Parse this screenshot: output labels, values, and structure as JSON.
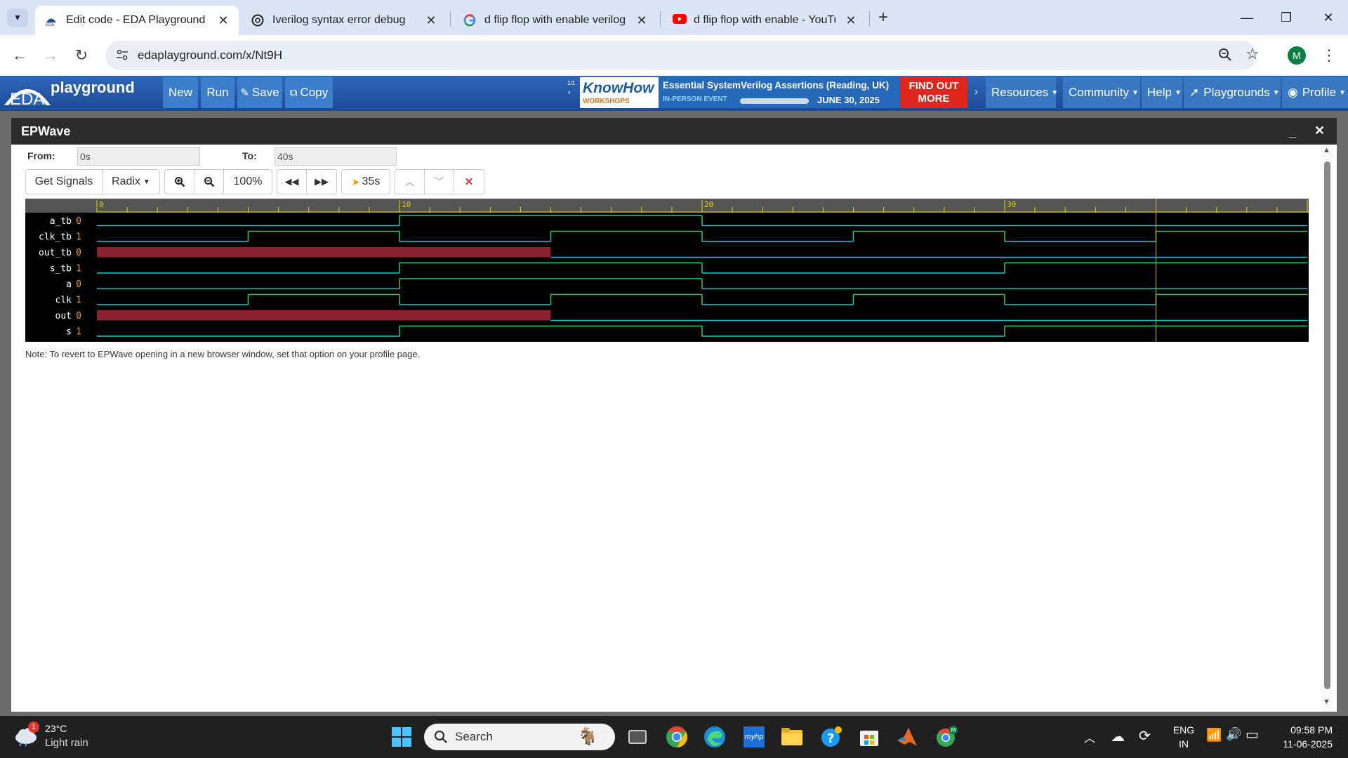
{
  "browser": {
    "tabs": [
      {
        "title": "Edit code - EDA Playground",
        "icon": "eda-icon",
        "active": true
      },
      {
        "title": "Iverilog syntax error debug",
        "icon": "chatgpt-icon",
        "active": false
      },
      {
        "title": "d flip flop with enable verilog co",
        "icon": "google-icon",
        "active": false
      },
      {
        "title": "d flip flop with enable - YouTub",
        "icon": "youtube-icon",
        "active": false
      }
    ],
    "url": "edaplayground.com/x/Nt9H",
    "profile_initial": "M"
  },
  "eda": {
    "logo_text": "EDA",
    "logo_word": "playground",
    "buttons": {
      "new": "New",
      "run": "Run",
      "save": "Save",
      "copy": "Copy"
    },
    "ad": {
      "counter": "1/1",
      "brand": "KnowHow",
      "brand_sub": "WORKSHOPS",
      "title": "Essential SystemVerilog Assertions (Reading, UK)",
      "event_type": "IN-PERSON EVENT",
      "date": "JUNE 30, 2025",
      "cta_line1": "FIND OUT",
      "cta_line2": "MORE"
    },
    "menus": [
      "Resources",
      "Community",
      "Help",
      "Playgrounds",
      "Profile"
    ]
  },
  "epwave": {
    "title": "EPWave",
    "from_label": "From:",
    "from_value": "0s",
    "to_label": "To:",
    "to_value": "40s",
    "get_signals": "Get Signals",
    "radix": "Radix",
    "zoom": "100%",
    "cursor_time": "35s",
    "note": "Note: To revert to EPWave opening in a new browser window, set that option on your profile page.",
    "time_labels": [
      "0",
      "10",
      "20",
      "30"
    ],
    "time_range": [
      0,
      40
    ],
    "cursor_at": 35,
    "signals": [
      {
        "name": "a_tb",
        "value": "0",
        "type": "bit",
        "initial": 0,
        "changes": [
          [
            10,
            1
          ],
          [
            20,
            0
          ]
        ]
      },
      {
        "name": "clk_tb",
        "value": "1",
        "type": "bit",
        "initial": 0,
        "changes": [
          [
            5,
            1
          ],
          [
            10,
            0
          ],
          [
            15,
            1
          ],
          [
            20,
            0
          ],
          [
            25,
            1
          ],
          [
            30,
            0
          ],
          [
            35,
            1
          ]
        ]
      },
      {
        "name": "out_tb",
        "value": "0",
        "type": "bit",
        "initial": "x",
        "changes": [
          [
            15,
            0
          ]
        ]
      },
      {
        "name": "s_tb",
        "value": "1",
        "type": "bit",
        "initial": 0,
        "changes": [
          [
            10,
            1
          ],
          [
            20,
            0
          ],
          [
            30,
            1
          ]
        ]
      },
      {
        "name": "a",
        "value": "0",
        "type": "bit",
        "initial": 0,
        "changes": [
          [
            10,
            1
          ],
          [
            20,
            0
          ]
        ]
      },
      {
        "name": "clk",
        "value": "1",
        "type": "bit",
        "initial": 0,
        "changes": [
          [
            5,
            1
          ],
          [
            10,
            0
          ],
          [
            15,
            1
          ],
          [
            20,
            0
          ],
          [
            25,
            1
          ],
          [
            30,
            0
          ],
          [
            35,
            1
          ]
        ]
      },
      {
        "name": "out",
        "value": "0",
        "type": "bit",
        "initial": "x",
        "changes": [
          [
            15,
            0
          ]
        ]
      },
      {
        "name": "s",
        "value": "1",
        "type": "bit",
        "initial": 0,
        "changes": [
          [
            10,
            1
          ],
          [
            20,
            0
          ],
          [
            30,
            1
          ]
        ]
      }
    ]
  },
  "taskbar": {
    "weather_temp": "23°C",
    "weather_desc": "Light rain",
    "weather_badge": "1",
    "search_placeholder": "Search",
    "lang_line1": "ENG",
    "lang_line2": "IN",
    "time": "09:58 PM",
    "date": "11-06-2025"
  },
  "colors": {
    "wave_green": "#22d36b",
    "wave_cyan": "#22c4d8",
    "undefined_fill": "#8b2232",
    "cursor": "#d9b23a",
    "eda_blue": "#2f66b8"
  }
}
